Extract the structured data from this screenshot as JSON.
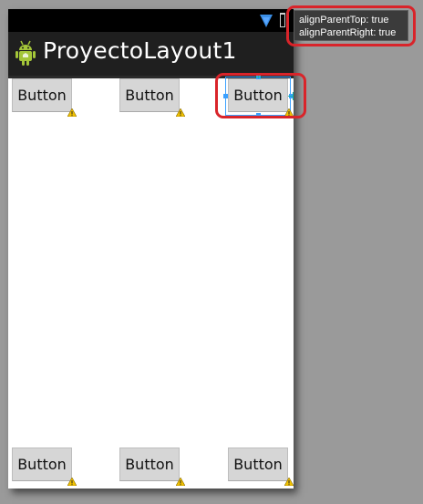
{
  "app": {
    "title": "ProyectoLayout1"
  },
  "icons": {
    "status_signal": "wifi-signal-icon",
    "status_battery": "battery-icon",
    "app_icon": "android-robot-icon",
    "lint_warning": "warning-icon"
  },
  "buttons": {
    "top_left": {
      "label": "Button"
    },
    "top_center": {
      "label": "Button"
    },
    "top_right": {
      "label": "Button"
    },
    "bottom_left": {
      "label": "Button"
    },
    "bottom_center": {
      "label": "Button"
    },
    "bottom_right": {
      "label": "Button"
    }
  },
  "tooltip": {
    "line1": "alignParentTop: true",
    "line2": "alignParentRight: true"
  },
  "colors": {
    "canvas_background": "#9a9a9a",
    "status_bar": "#000000",
    "action_bar": "#1f1f1f",
    "button_fill": "#d6d6d6",
    "selection_blue": "#3aa0ff",
    "anchor_teal": "#16b3a6",
    "highlight_red": "#d9242a",
    "warning_yellow": "#f2c200"
  }
}
